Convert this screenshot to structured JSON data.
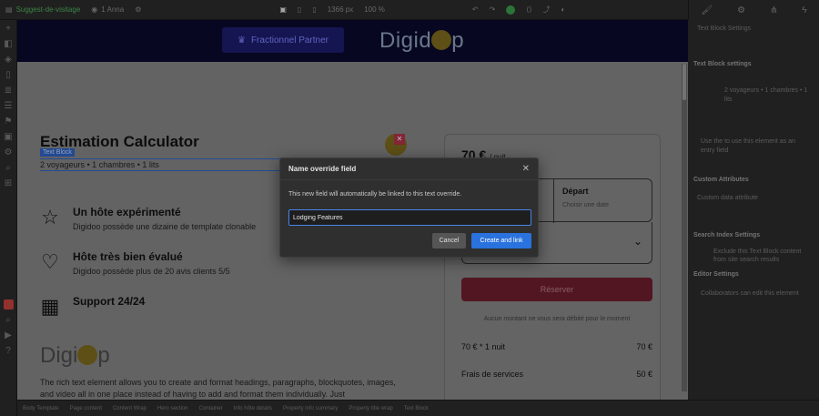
{
  "topbar": {
    "page_name": "Suggest-de-visitage",
    "mode": "1 Anna",
    "canvas_width": "1366 px",
    "zoom": "100 %"
  },
  "right_tabs": {
    "style": "brush-icon",
    "settings": "gear-icon",
    "interactions": "nodes-icon",
    "more": "bolt-icon"
  },
  "site": {
    "promo_button": "Fractionnel Partner",
    "logo_text": "Digid",
    "logo_suffix": "p"
  },
  "page": {
    "title": "Estimation Calculator",
    "selected_tag": "Text Block",
    "subtitle": "2 voyageurs • 1 chambres • 1 lits",
    "features": [
      {
        "icon": "star-icon",
        "title": "Un hôte expérimenté",
        "text": "Digidoo possède une dizaine de template clonable"
      },
      {
        "icon": "heart-icon",
        "title": "Hôte très bien évalué",
        "text": "Digidoo possède plus de 20 avis clients 5/5"
      },
      {
        "icon": "calendar-icon",
        "title": "Support 24/24",
        "text": ""
      }
    ],
    "logo_mid_text": "Digi",
    "logo_mid_suffix": "p",
    "richtext": "The rich text element allows you to create and format headings, paragraphs, blockquotes, images, and video all in one place instead of having to add and format them individually. Just"
  },
  "booking": {
    "price": "70 €",
    "price_unit": "/ nuit",
    "depart_label": "Départ",
    "depart_placeholder": "Choisir une date",
    "reserve_label": "Réserver",
    "note": "Aucun montant ne vous sera débité pour le moment",
    "rows": [
      {
        "label": "70 € * 1 nuit",
        "value": "70 €"
      },
      {
        "label": "Frais de services",
        "value": "50 €"
      }
    ]
  },
  "right_panel": {
    "sections": [
      "Text Block settings",
      "Custom Attributes",
      "Search Index Settings",
      "Editor Settings"
    ],
    "lines": [
      "Text Block Settings",
      "2 voyageurs • 1 chambres • 1",
      "lits",
      "Use the  to use this element as an",
      "entry field",
      "Custom Attributes",
      "Custom data attribute",
      "Search Index Settings",
      "Exclude this Text Block content",
      "from site search results",
      "Editor Settings",
      "Collaborators can edit this element"
    ]
  },
  "bottombar": {
    "crumbs": [
      "Body Template",
      "Page content",
      "Content Wrap",
      "Hero section",
      "Container",
      "Info hôte details",
      "Property info summary",
      "Property title wrap",
      "Text Block"
    ]
  },
  "modal": {
    "title": "Name override field",
    "description": "This new field will automatically be linked to this text override.",
    "input_value": "Lodging Features",
    "cancel_label": "Cancel",
    "create_label": "Create and link"
  }
}
